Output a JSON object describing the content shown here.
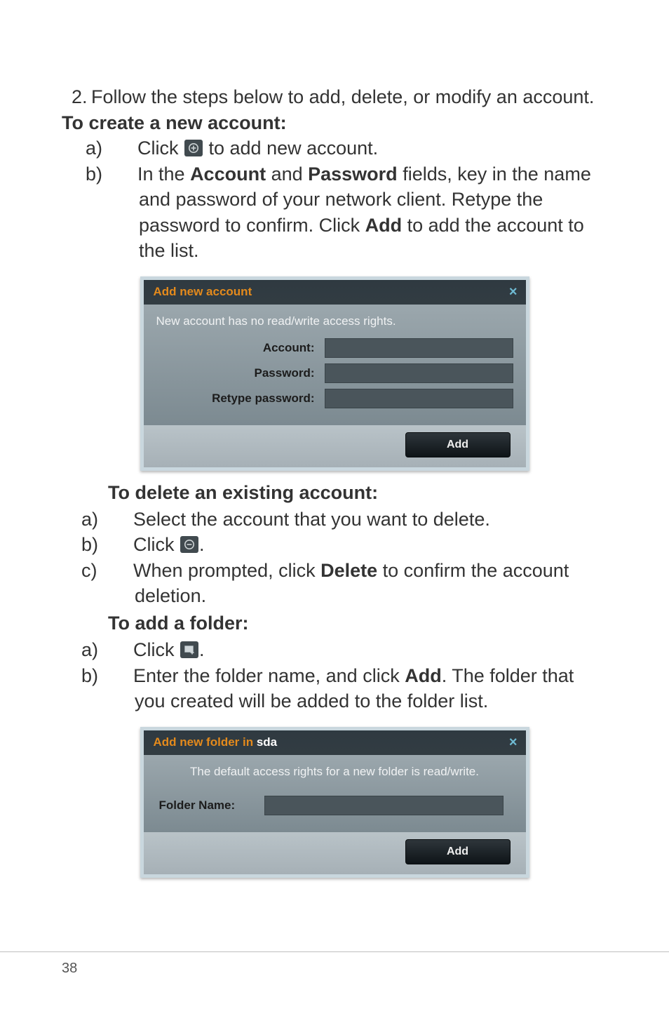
{
  "intro": {
    "step_num": "2.",
    "step_text": "Follow the steps below to add, delete, or modify an account."
  },
  "create": {
    "heading": "To create a new account:",
    "a": {
      "lbl": "a)",
      "before": "Click ",
      "after": " to add new account."
    },
    "b": {
      "lbl": "b)",
      "t1": "In the ",
      "b1": "Account",
      "t2": " and ",
      "b2": "Password",
      "t3": " fields, key in the name and password of your network client. Retype the password to confirm. Click ",
      "b3": "Add",
      "t4": " to add the account to the list."
    }
  },
  "dialog_add_account": {
    "title": "Add new account",
    "close": "×",
    "msg": "New account has no read/write access rights.",
    "account_label": "Account:",
    "password_label": "Password:",
    "retype_label": "Retype password:",
    "account_value": "",
    "password_value": "",
    "retype_value": "",
    "add_btn": "Add"
  },
  "delete": {
    "heading": "To delete an existing account:",
    "a": {
      "lbl": "a)",
      "text": "Select the account that you want to delete."
    },
    "b": {
      "lbl": "b)",
      "before": "Click ",
      "after": "."
    },
    "c": {
      "lbl": "c)",
      "t1": "When prompted, click ",
      "b1": "Delete",
      "t2": " to confirm the account deletion."
    }
  },
  "folder": {
    "heading": "To add a folder:",
    "a": {
      "lbl": "a)",
      "before": "Click ",
      "after": "."
    },
    "b": {
      "lbl": "b)",
      "t1": "Enter the folder name, and click ",
      "b1": "Add",
      "t2": ". The folder that you created will be added to the folder list."
    }
  },
  "dialog_add_folder": {
    "title_prefix": "Add new folder in ",
    "title_target": "sda",
    "close": "×",
    "msg": "The default access rights for a new folder is read/write.",
    "name_label": "Folder Name:",
    "name_value": "",
    "add_btn": "Add"
  },
  "page_number": "38"
}
